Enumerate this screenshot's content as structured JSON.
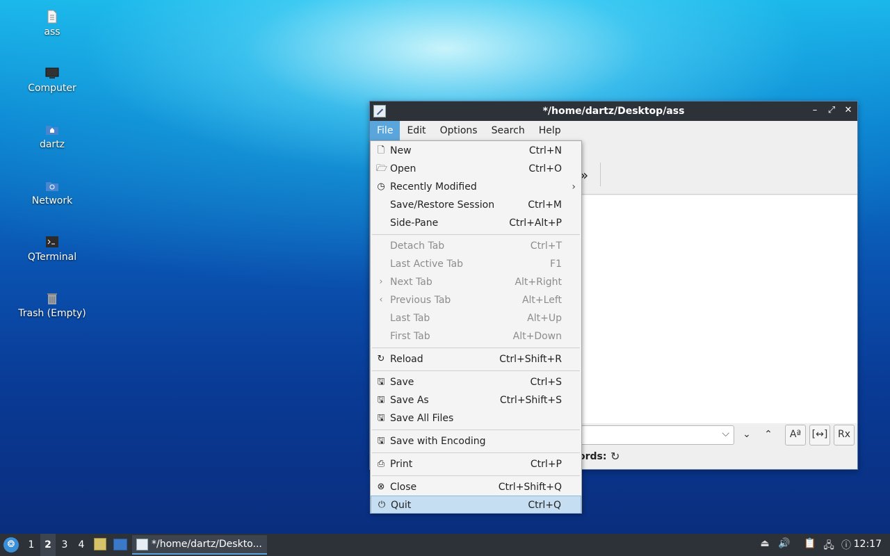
{
  "desktop": {
    "icons": [
      {
        "label": "ass",
        "icon": "text-file-icon"
      },
      {
        "label": "Computer",
        "icon": "computer-icon"
      },
      {
        "label": "dartz",
        "icon": "home-folder-icon"
      },
      {
        "label": "Network",
        "icon": "network-folder-icon"
      },
      {
        "label": "QTerminal",
        "icon": "terminal-icon"
      },
      {
        "label": "Trash (Empty)",
        "icon": "trash-icon"
      }
    ]
  },
  "window": {
    "title": "*/home/dartz/Desktop/ass",
    "controls": {
      "minimize": "–",
      "maximize": "⤢",
      "close": "✕"
    },
    "menubar": [
      "File",
      "Edit",
      "Options",
      "Search",
      "Help"
    ],
    "toolbar_more": "»",
    "status_words_label": "ords:"
  },
  "file_menu": {
    "items": [
      {
        "label": "New",
        "shortcut": "Ctrl+N",
        "icon": "new-document-icon",
        "glyph": "🗋",
        "enabled": true
      },
      {
        "label": "Open",
        "shortcut": "Ctrl+O",
        "icon": "open-folder-icon",
        "glyph": "🗁",
        "enabled": true
      },
      {
        "label": "Recently Modified",
        "shortcut": "",
        "icon": "clock-icon",
        "glyph": "◷",
        "enabled": true,
        "submenu": "›"
      },
      {
        "label": "Save/Restore Session",
        "shortcut": "Ctrl+M",
        "icon": "",
        "glyph": "",
        "enabled": true
      },
      {
        "label": "Side-Pane",
        "shortcut": "Ctrl+Alt+P",
        "icon": "",
        "glyph": "",
        "enabled": true
      },
      {
        "label": "Detach Tab",
        "shortcut": "Ctrl+T",
        "icon": "",
        "glyph": "",
        "enabled": false
      },
      {
        "label": "Last Active Tab",
        "shortcut": "F1",
        "icon": "",
        "glyph": "",
        "enabled": false
      },
      {
        "label": "Next Tab",
        "shortcut": "Alt+Right",
        "icon": "chevron-right-icon",
        "glyph": "›",
        "enabled": false
      },
      {
        "label": "Previous Tab",
        "shortcut": "Alt+Left",
        "icon": "chevron-left-icon",
        "glyph": "‹",
        "enabled": false
      },
      {
        "label": "Last Tab",
        "shortcut": "Alt+Up",
        "icon": "",
        "glyph": "",
        "enabled": false
      },
      {
        "label": "First Tab",
        "shortcut": "Alt+Down",
        "icon": "",
        "glyph": "",
        "enabled": false
      },
      {
        "label": "Reload",
        "shortcut": "Ctrl+Shift+R",
        "icon": "reload-icon",
        "glyph": "↻",
        "enabled": true
      },
      {
        "label": "Save",
        "shortcut": "Ctrl+S",
        "icon": "save-icon",
        "glyph": "🖫",
        "enabled": true
      },
      {
        "label": "Save As",
        "shortcut": "Ctrl+Shift+S",
        "icon": "save-as-icon",
        "glyph": "🖫",
        "enabled": true
      },
      {
        "label": "Save All Files",
        "shortcut": "",
        "icon": "save-all-icon",
        "glyph": "🖫",
        "enabled": true
      },
      {
        "label": "Save with Encoding",
        "shortcut": "",
        "icon": "save-encoding-icon",
        "glyph": "🖫",
        "enabled": true
      },
      {
        "label": "Print",
        "shortcut": "Ctrl+P",
        "icon": "printer-icon",
        "glyph": "⎙",
        "enabled": true
      },
      {
        "label": "Close",
        "shortcut": "Ctrl+Shift+Q",
        "icon": "close-circle-icon",
        "glyph": "⊗",
        "enabled": true
      },
      {
        "label": "Quit",
        "shortcut": "Ctrl+Q",
        "icon": "power-icon",
        "glyph": "⏻",
        "enabled": true,
        "selected": true
      }
    ]
  },
  "searchbar": {
    "dropdown_arrow": "⌵",
    "next": "⌄",
    "prev": "⌃",
    "match_case": "Aª",
    "whole_word": "[↔]",
    "regex": "Rx"
  },
  "taskbar": {
    "start_icon": "start-menu-icon",
    "workspaces": [
      "1",
      "2",
      "3",
      "4"
    ],
    "active_workspace": "2",
    "task_label": "*/home/dartz/Deskto...",
    "clock": "12:17",
    "tray_icons": [
      "eject-icon",
      "volume-icon",
      "clipboard-icon",
      "network-icon",
      "update-notifier-icon"
    ]
  }
}
